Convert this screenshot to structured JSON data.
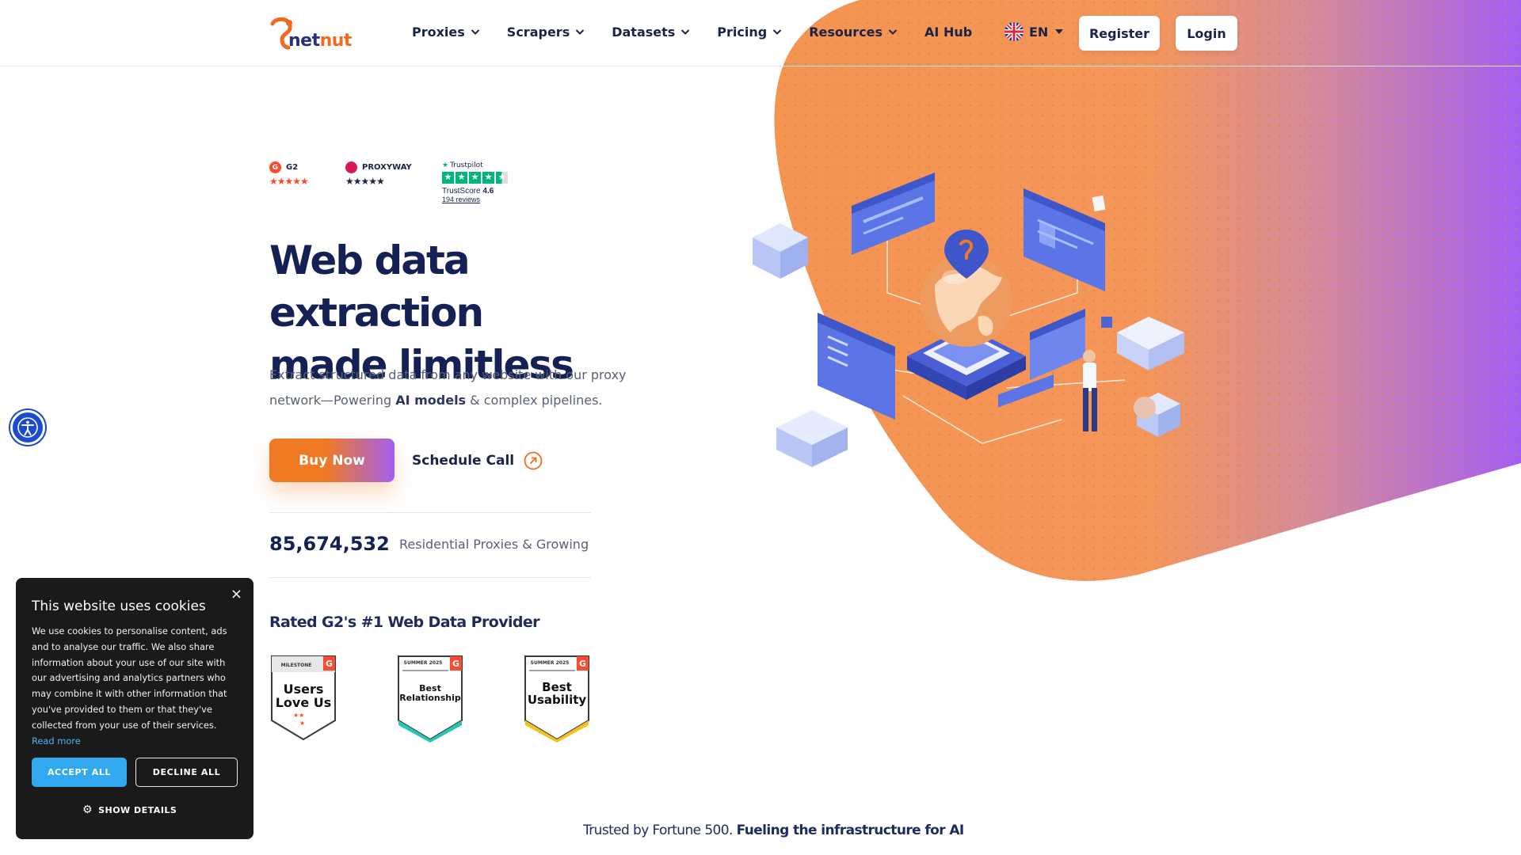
{
  "brand": {
    "logo_part1": "net",
    "logo_part2": "nut",
    "accent_orange": "#f07a23",
    "accent_purple": "#a35ff0",
    "navy": "#142154"
  },
  "nav": {
    "items": [
      {
        "label": "Proxies"
      },
      {
        "label": "Scrapers"
      },
      {
        "label": "Datasets"
      },
      {
        "label": "Pricing"
      },
      {
        "label": "Resources"
      },
      {
        "label": "AI Hub"
      }
    ],
    "language": "EN",
    "register": "Register",
    "login": "Login"
  },
  "ratings": {
    "g2": {
      "name": "G2",
      "stars": "★★★★★"
    },
    "proxyway": {
      "name": "PROXYWAY",
      "stars": "★★★★★"
    },
    "trustpilot": {
      "name": "Trustpilot",
      "score_label": "TrustScore",
      "score": "4.6",
      "reviews": "194 reviews"
    }
  },
  "hero": {
    "headline_line1": "Web data extraction",
    "headline_line2": "made limitless",
    "sub_part1": "Extract structured data from any website with our proxy network—Powering ",
    "sub_bold": "AI models",
    "sub_part2": " & complex pipelines.",
    "buy_now": "Buy Now",
    "schedule_call": "Schedule Call"
  },
  "stats": {
    "number": "85,674,532",
    "label": "Residential Proxies & Growing"
  },
  "awards": {
    "heading": "Rated G2's #1 Web Data Provider",
    "badges": [
      {
        "top": "MILESTONE",
        "line1": "Users",
        "line2": "Love Us"
      },
      {
        "top": "SUMMER 2025",
        "line1": "Best",
        "line2": "Relationship"
      },
      {
        "top": "SUMMER 2025",
        "line1": "Best",
        "line2": "Usability"
      }
    ]
  },
  "trusted": {
    "plain": "Trusted by Fortune 500. ",
    "bold": "Fueling the infrastructure for AI"
  },
  "cookie": {
    "title": "This website uses cookies",
    "body": "We use cookies to personalise content, ads and to analyse our traffic. We also share information about your use of our site with our advertising and analytics partners who may combine it with other information that you've provided to them or that they've collected from your use of their services.",
    "read_more": "Read more",
    "accept": "ACCEPT ALL",
    "decline": "DECLINE ALL",
    "show_details": "SHOW DETAILS",
    "close": "×"
  },
  "icons": {
    "nav_chevron": "chevron-down-icon",
    "lang_flag": "uk-flag-icon",
    "schedule_arrow": "arrow-up-right-circle-icon",
    "accessibility": "accessibility-icon",
    "cookie_gear": "gear-icon"
  }
}
